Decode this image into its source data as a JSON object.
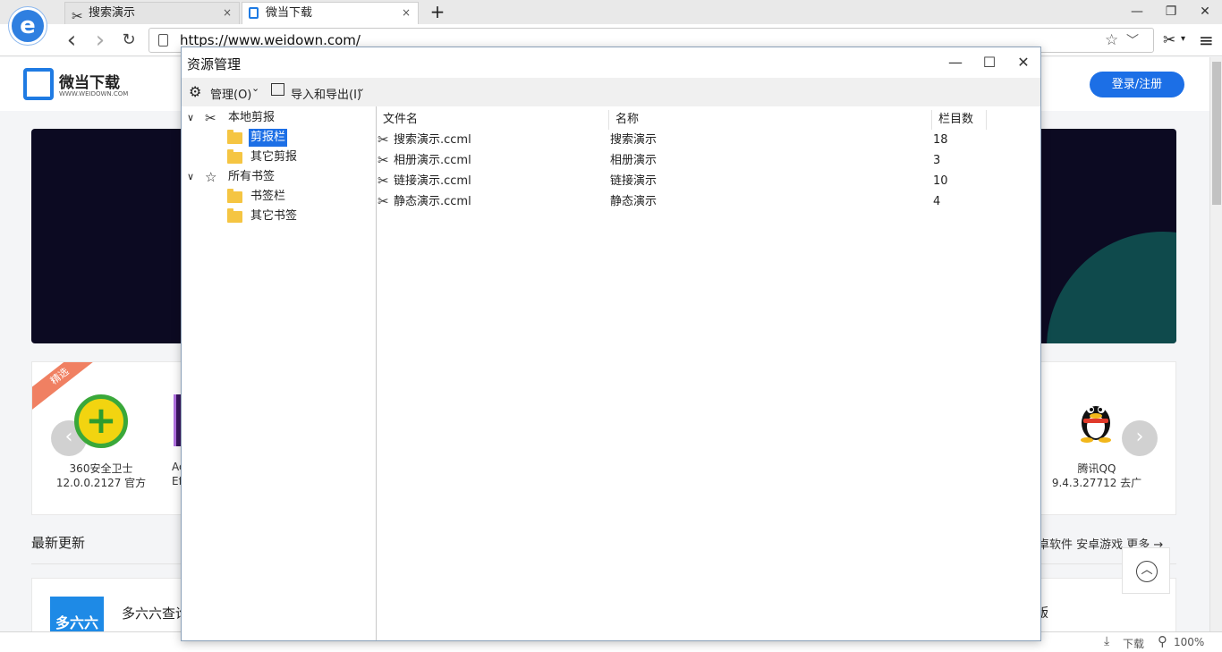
{
  "browser": {
    "logo_text": "e",
    "tabs": [
      {
        "label": "搜索演示",
        "close": "×"
      },
      {
        "label": "微当下载",
        "close": "×"
      }
    ],
    "new_tab": "+",
    "window": {
      "minimize": "—",
      "restore": "❐",
      "close": "✕"
    },
    "nav": {
      "back": "‹",
      "forward": "›",
      "refresh": "↻"
    },
    "address": "https://www.weidown.com/",
    "addr_icons": {
      "star": "☆",
      "dropdown": "﹀"
    },
    "toolbar_icons": {
      "scissors": "✂",
      "scissors_drop": "▾",
      "menu": "≡"
    }
  },
  "site": {
    "name": "微当下载",
    "domain": "WWW.WEIDOWN.COM",
    "login": "登录/注册",
    "ribbon": "精选",
    "featured_apps": [
      {
        "name": "360安全卫士",
        "version": "12.0.0.2127 官方"
      },
      {
        "name": "Ac",
        "version": "Ef"
      },
      {
        "name": "腾讯QQ",
        "version": "9.4.3.27712 去广"
      }
    ],
    "carousel_prev": "‹",
    "carousel_next": "›",
    "latest_title": "最新更新",
    "latest_links": "卓软件   安卓游戏   更多 →",
    "latest_app_icon": "多六六",
    "latest_app_name": "多六六查询",
    "latest_app_right": "版",
    "scroll_top": "︿"
  },
  "statusbar": {
    "download": "下载",
    "zoom": "100%"
  },
  "dialog": {
    "title": "资源管理",
    "controls": {
      "minimize": "—",
      "maximize": "☐",
      "close": "✕"
    },
    "toolbar": [
      {
        "label": "管理(O)",
        "caret": "⌄"
      },
      {
        "label": "导入和导出(I)",
        "caret": "⌄"
      }
    ],
    "tree": {
      "local_clips": {
        "label": "本地剪报",
        "children": [
          "剪报栏",
          "其它剪报"
        ]
      },
      "bookmarks": {
        "label": "所有书签",
        "children": [
          "书签栏",
          "其它书签"
        ]
      }
    },
    "columns": [
      "文件名",
      "名称",
      "栏目数"
    ],
    "rows": [
      {
        "file": "搜索演示.ccml",
        "name": "搜索演示",
        "count": "18"
      },
      {
        "file": "相册演示.ccml",
        "name": "相册演示",
        "count": "3"
      },
      {
        "file": "链接演示.ccml",
        "name": "链接演示",
        "count": "10"
      },
      {
        "file": "静态演示.ccml",
        "name": "静态演示",
        "count": "4"
      }
    ]
  },
  "colors": {
    "accent": "#1c6fe6",
    "folder": "#f5c542",
    "banner": "#0c0a22"
  }
}
